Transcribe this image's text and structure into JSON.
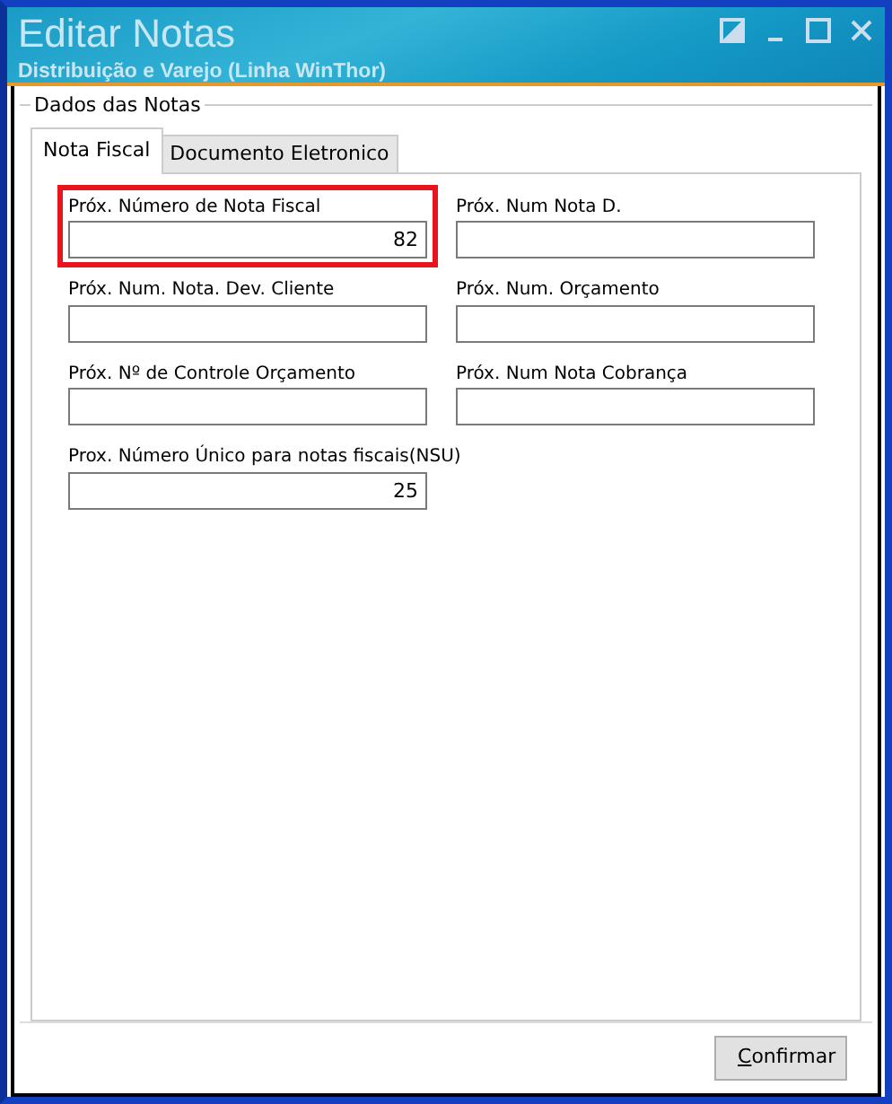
{
  "window": {
    "title": "Editar Notas",
    "subtitle": "Distribuição e Varejo (Linha WinThor)"
  },
  "group": {
    "title": "Dados das Notas"
  },
  "tabs": [
    {
      "label": "Nota Fiscal",
      "selected": true
    },
    {
      "label": "Documento Eletronico",
      "selected": false
    }
  ],
  "fields": [
    {
      "label": "Próx. Número de Nota Fiscal",
      "value": "82",
      "highlighted": true
    },
    {
      "label": "Próx. Num Nota D.",
      "highlighted": false
    },
    {
      "label": "Próx. Num. Nota. Dev. Cliente",
      "highlighted": false
    },
    {
      "label": "Próx. Num. Orçamento",
      "highlighted": false
    },
    {
      "label": "Próx. Nº de Controle Orçamento",
      "highlighted": false
    },
    {
      "label": "Próx. Num Nota Cobrança",
      "highlighted": false
    },
    {
      "label": "Prox. Número Único para notas fiscais(NSU)",
      "value": "25",
      "highlighted": false
    }
  ],
  "buttons": [
    {
      "label": "Confirmar"
    }
  ]
}
